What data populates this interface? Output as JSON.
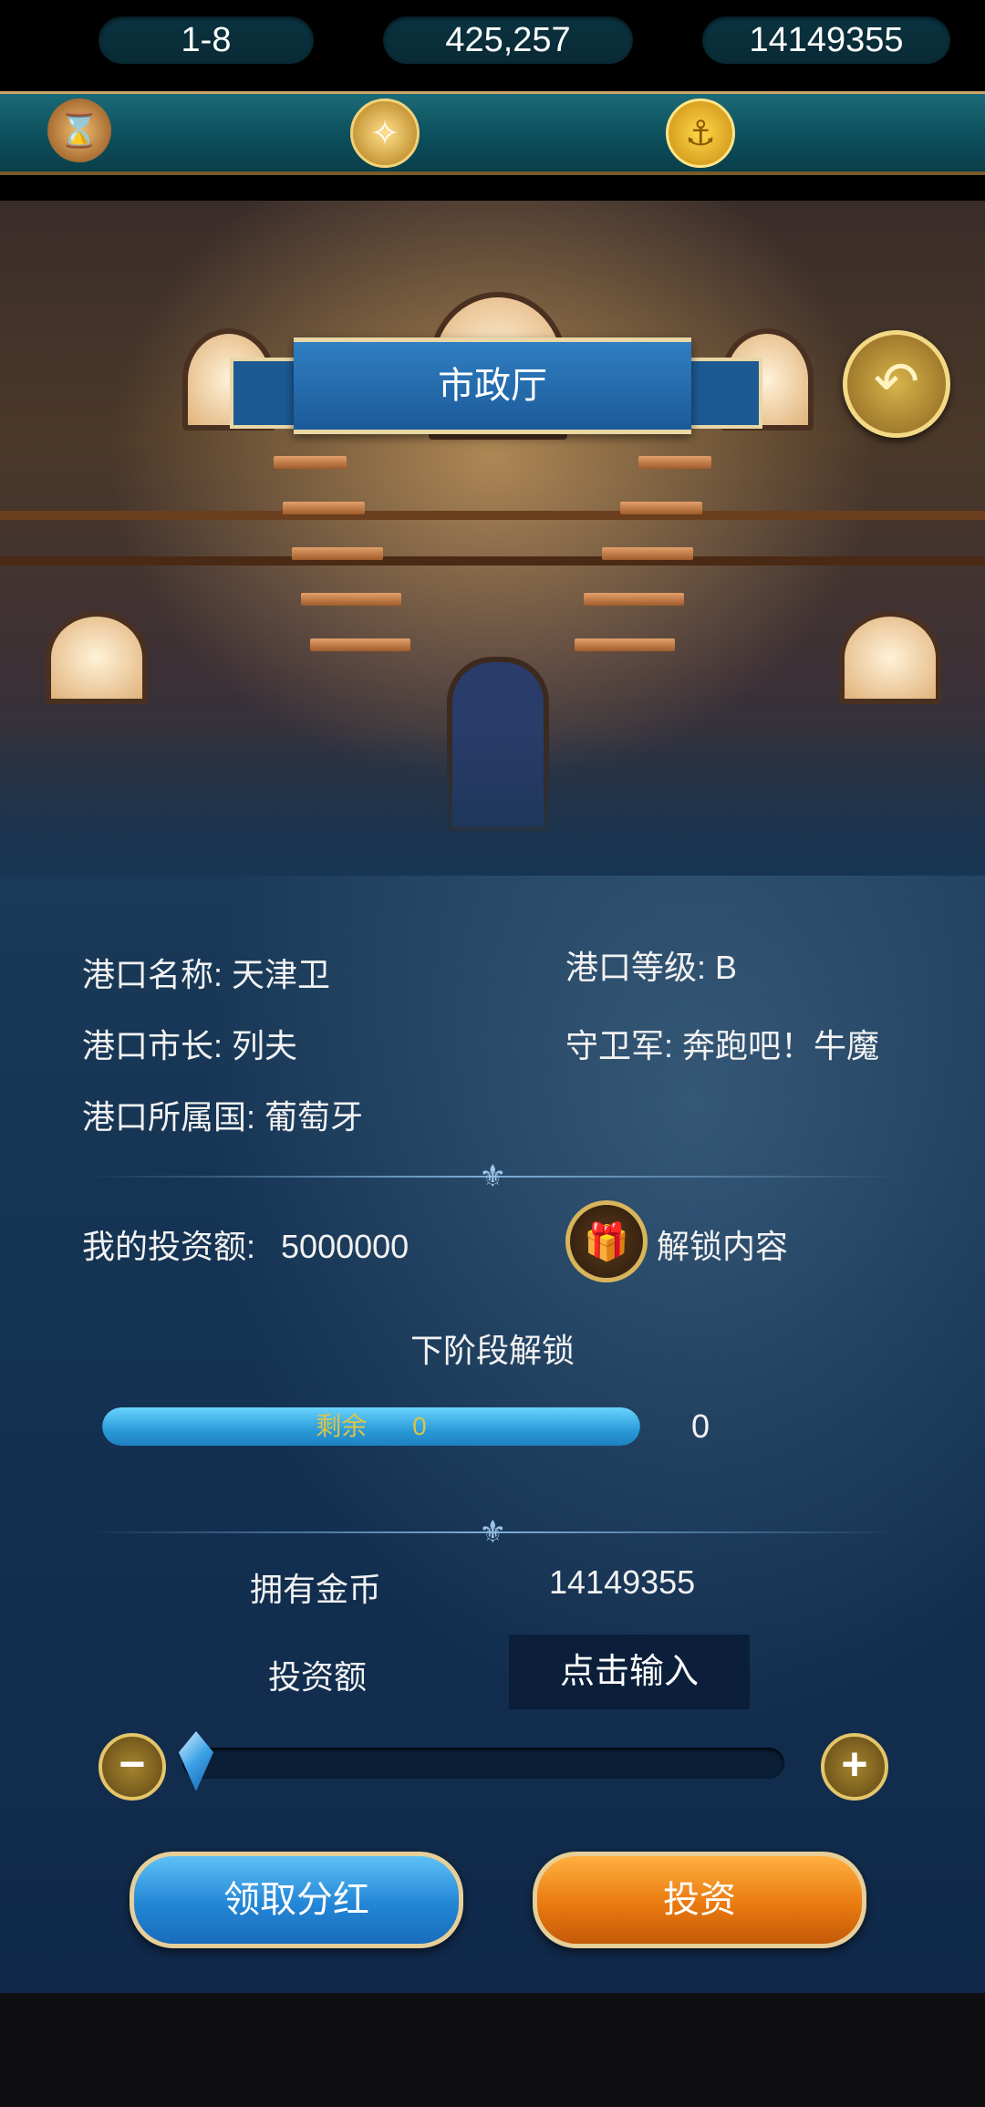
{
  "topbar": {
    "level": "1-8",
    "silver": "425,257",
    "gold": "14149355",
    "level_icon": "hourglass-icon",
    "silver_icon": "compass-coin-icon",
    "gold_icon": "anchor-coin-icon"
  },
  "banner": {
    "title": "市政厅"
  },
  "back_button": {
    "icon": "back-arrow-icon"
  },
  "port": {
    "name_label": "港口名称:",
    "name": "天津卫",
    "level_label": "港口等级:",
    "level": "B",
    "mayor_label": "港口市长:",
    "mayor": "列夫",
    "guard_label": "守卫军:",
    "guard": "奔跑吧！牛魔",
    "nation_label": "港口所属国:",
    "nation": "葡萄牙"
  },
  "investment": {
    "my_label": "我的投资额:",
    "my_amount": "5000000",
    "unlock_label": "解锁内容",
    "unlock_icon": "gift-box-icon",
    "next_stage": "下阶段解锁",
    "progress_text_label": "剩余",
    "progress_text_value": "0",
    "progress_value": 1.0,
    "progress_count": "0"
  },
  "funds": {
    "own_label": "拥有金币",
    "own_value": "14149355",
    "invest_label": "投资额",
    "input_placeholder": "点击输入"
  },
  "slider": {
    "value": 0
  },
  "actions": {
    "dividend_label": "领取分红",
    "invest_label": "投资"
  },
  "colors": {
    "panel": "#143252",
    "button_blue": "#2386d6",
    "button_orange": "#ea7a10",
    "gold_trim": "#e6cf98"
  }
}
